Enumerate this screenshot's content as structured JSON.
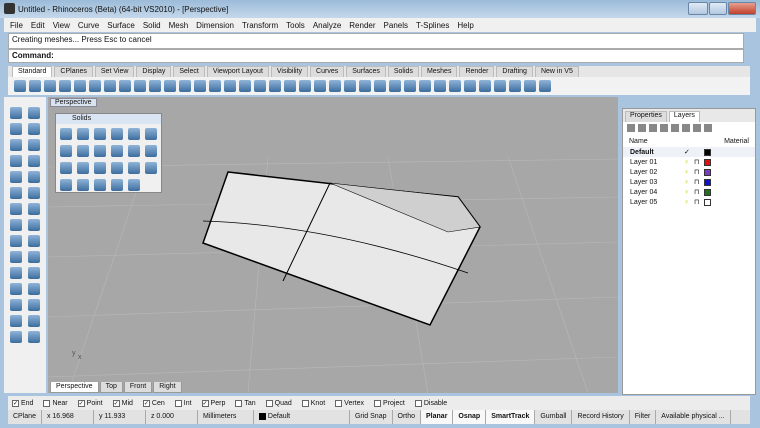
{
  "title": "Untitled - Rhinoceros (Beta) (64-bit VS2010) - [Perspective]",
  "menu": [
    "File",
    "Edit",
    "View",
    "Curve",
    "Surface",
    "Solid",
    "Mesh",
    "Dimension",
    "Transform",
    "Tools",
    "Analyze",
    "Render",
    "Panels",
    "T-Splines",
    "Help"
  ],
  "command": {
    "history": "Creating meshes... Press Esc to cancel",
    "prompt": "Command:"
  },
  "toolbar_tabs": [
    "Standard",
    "CPlanes",
    "Set View",
    "Display",
    "Select",
    "Viewport Layout",
    "Visibility",
    "Curves",
    "Surfaces",
    "Solids",
    "Meshes",
    "Render",
    "Drafting",
    "New in V5"
  ],
  "viewport": {
    "label": "Perspective",
    "tabs": [
      "Perspective",
      "Top",
      "Front",
      "Right"
    ]
  },
  "solids_panel": {
    "title": "Solids"
  },
  "panel": {
    "tabs": [
      "Properties",
      "Layers"
    ],
    "col_name": "Name",
    "col_material": "Material",
    "layers": [
      {
        "name": "Default",
        "current": "✓",
        "color": "#000000"
      },
      {
        "name": "Layer 01",
        "color": "#e01010"
      },
      {
        "name": "Layer 02",
        "color": "#7a3cc0"
      },
      {
        "name": "Layer 03",
        "color": "#1010d0"
      },
      {
        "name": "Layer 04",
        "color": "#207020"
      },
      {
        "name": "Layer 05",
        "color": "#ffffff"
      }
    ]
  },
  "osnap": [
    {
      "label": "End",
      "on": true
    },
    {
      "label": "Near",
      "on": false
    },
    {
      "label": "Point",
      "on": true
    },
    {
      "label": "Mid",
      "on": true
    },
    {
      "label": "Cen",
      "on": true
    },
    {
      "label": "Int",
      "on": false
    },
    {
      "label": "Perp",
      "on": true
    },
    {
      "label": "Tan",
      "on": false
    },
    {
      "label": "Quad",
      "on": false
    },
    {
      "label": "Knot",
      "on": false
    },
    {
      "label": "Vertex",
      "on": false
    },
    {
      "label": "Project",
      "on": false
    },
    {
      "label": "Disable",
      "on": false
    }
  ],
  "status": {
    "cplane": "CPlane",
    "x": "x 16.968",
    "y": "y 11.933",
    "z": "z 0.000",
    "units": "Millimeters",
    "layer": "Default",
    "grid_snap": "Grid Snap",
    "ortho": "Ortho",
    "planar": "Planar",
    "osnap": "Osnap",
    "smarttrack": "SmartTrack",
    "gumball": "Gumball",
    "record_history": "Record History",
    "filter": "Filter",
    "memory": "Available physical ..."
  }
}
